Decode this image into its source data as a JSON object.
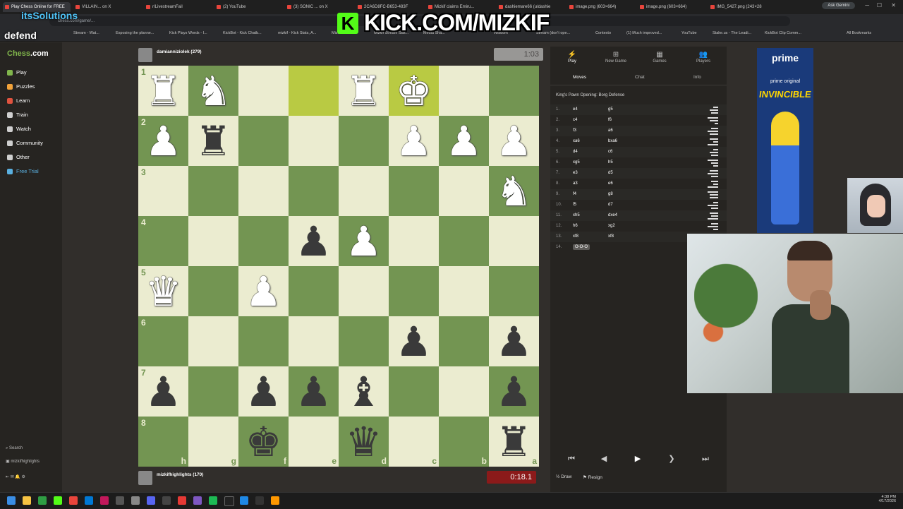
{
  "browser": {
    "tabs": [
      "Play Chess Online for FREE",
      "VILLAIN... on X",
      "r/LivestreamFail",
      "(2) YouTube",
      "(3) SONIC ... on X",
      "2CA6D8FC-B653-483F",
      "Mizkif claims Emiru...",
      "dashiemare66 (u/dashie",
      "image.png (603×664)",
      "image.png (603×664)",
      "IMG_5427.png (243×28"
    ],
    "url": "chess.com/game/...",
    "ask_gemini": "Ask Gemini",
    "bookmarks": [
      "Stream - Wat...",
      "Exposing the planne...",
      "Kick Plays Words - I...",
      "KickBot - Kick Chatb...",
      "mizkif - Kick Stats, A...",
      "Mizkif - Twitch",
      "Mizkif Stream Stat...",
      "Media Sha...",
      "Wisdom",
      "Stream (don't ope...",
      "Contexto",
      "(1) Much improved...",
      "YouTube",
      "Stake.us - The Leadi...",
      "KickBot Clip Comm...",
      "All Bookmarks"
    ]
  },
  "overlay": {
    "kick_url": "KICK.COM/MIZKIF",
    "kick_logo": "K",
    "caption_a": "itsSolutions",
    "caption_b": "defend"
  },
  "sidebar": {
    "logo_a": "Chess",
    "logo_b": ".com",
    "items": [
      {
        "label": "Play",
        "color": "#81b64c"
      },
      {
        "label": "Puzzles",
        "color": "#f2a33a"
      },
      {
        "label": "Learn",
        "color": "#e0533f"
      },
      {
        "label": "Train",
        "color": "#cfcfcf"
      },
      {
        "label": "Watch",
        "color": "#cfcfcf"
      },
      {
        "label": "Community",
        "color": "#cfcfcf"
      },
      {
        "label": "Other",
        "color": "#cfcfcf"
      },
      {
        "label": "Free Trial",
        "color": "#5ab0e0"
      }
    ],
    "search": "Search",
    "username": "mizkifhighlights"
  },
  "game": {
    "top_player": {
      "name": "damianniziolek (279)",
      "clock": "1:03"
    },
    "bottom_player": {
      "name": "mizkifhighlights (170)",
      "clock": "0:18.1"
    },
    "ranks": [
      "1",
      "2",
      "3",
      "4",
      "5",
      "6",
      "7",
      "8"
    ],
    "files": [
      "h",
      "g",
      "f",
      "e",
      "d",
      "c",
      "b",
      "a"
    ],
    "pieces": {
      "wr": "♜",
      "wn": "♞",
      "wb": "♝",
      "wq": "♛",
      "wk": "♚",
      "wp": "♟",
      "br": "♜",
      "bn": "♞",
      "bb": "♝",
      "bq": "♛",
      "bk": "♚",
      "bp": "♟"
    }
  },
  "panel": {
    "tabs": [
      {
        "label": "Play",
        "glyph": "⚡"
      },
      {
        "label": "New Game",
        "glyph": "⊞"
      },
      {
        "label": "Games",
        "glyph": "▦"
      },
      {
        "label": "Players",
        "glyph": "👥"
      }
    ],
    "subtabs": [
      "Moves",
      "Chat",
      "Info"
    ],
    "opening": "King's Pawn Opening: Borg Defense",
    "moves": [
      {
        "n": "1.",
        "w": "e4",
        "b": "g5"
      },
      {
        "n": "2.",
        "w": "c4",
        "b": "f6"
      },
      {
        "n": "3.",
        "w": "f3",
        "b": "a6"
      },
      {
        "n": "4.",
        "w": "xa6",
        "b": "bxa6"
      },
      {
        "n": "5.",
        "w": "d4",
        "b": "c6"
      },
      {
        "n": "6.",
        "w": "xg5",
        "b": "h5"
      },
      {
        "n": "7.",
        "w": "e3",
        "b": "d5"
      },
      {
        "n": "8.",
        "w": "a3",
        "b": "e6"
      },
      {
        "n": "9.",
        "w": "f4",
        "b": "g8"
      },
      {
        "n": "10.",
        "w": "f5",
        "b": "d7"
      },
      {
        "n": "11.",
        "w": "xh5",
        "b": "dxe4"
      },
      {
        "n": "12.",
        "w": "h6",
        "b": "xg2"
      },
      {
        "n": "13.",
        "w": "xf8",
        "b": "xf8"
      },
      {
        "n": "14.",
        "w": "O-O-O",
        "b": ""
      }
    ],
    "draw": "Draw",
    "resign": "Resign"
  },
  "ad": {
    "brand": "prime",
    "sub": "prime original",
    "title": "INVINCIBLE"
  },
  "taskbar": {
    "time": "4:38 PM",
    "date": "4/17/2026"
  }
}
